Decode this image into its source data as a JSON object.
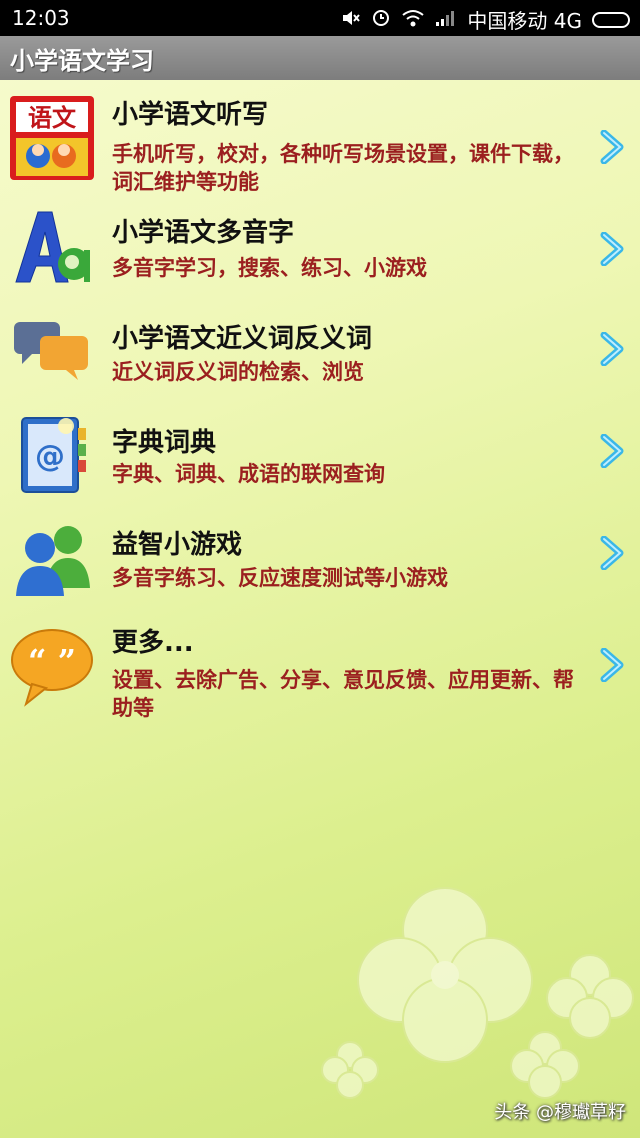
{
  "status_bar": {
    "time": "12:03",
    "carrier": "中国移动 4G",
    "icons": [
      "mute-icon",
      "alarm-icon",
      "wifi-icon",
      "signal-icon",
      "battery-icon"
    ]
  },
  "app": {
    "title": "小学语文学习"
  },
  "menu": [
    {
      "title": "小学语文听写",
      "desc": "手机听写，校对，各种听写场景设置，课件下载，词汇维护等功能",
      "icon": "yuwen-book-icon"
    },
    {
      "title": "小学语文多音字",
      "desc": "多音字学习，搜索、练习、小游戏",
      "icon": "letters-aa-icon"
    },
    {
      "title": "小学语文近义词反义词",
      "desc": "近义词反义词的检索、浏览",
      "icon": "chat-bubbles-icon"
    },
    {
      "title": "字典词典",
      "desc": "字典、词典、成语的联网查询",
      "icon": "address-book-icon"
    },
    {
      "title": "益智小游戏",
      "desc": "多音字练习、反应速度测试等小游戏",
      "icon": "users-icon"
    },
    {
      "title": "更多...",
      "desc": "设置、去除广告、分享、意见反馈、应用更新、帮助等",
      "icon": "quote-bubble-icon"
    }
  ],
  "watermark": "头条 @穆瓛草籽",
  "colors": {
    "title_bar": "#8a8a8a",
    "desc_text": "#9b1f1f",
    "arrow": "#3ab7e8"
  }
}
